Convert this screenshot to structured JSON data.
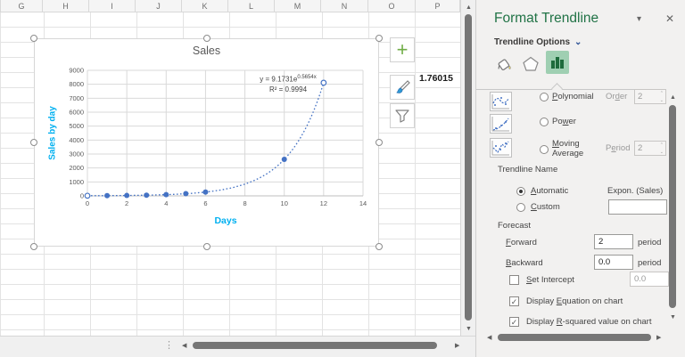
{
  "spreadsheet": {
    "columns": [
      "G",
      "H",
      "I",
      "J",
      "K",
      "L",
      "M",
      "N",
      "O",
      "P"
    ],
    "cell_value": "1.76015"
  },
  "chart_buttons": {
    "elements_icon": "+",
    "styles_icon": "brush",
    "filters_icon": "funnel"
  },
  "chart_data": {
    "type": "scatter",
    "title": "Sales",
    "xlabel": "Days",
    "ylabel": "Sales by day",
    "xlim": [
      0,
      14
    ],
    "ylim": [
      0,
      9000
    ],
    "x_ticks": [
      0,
      2,
      4,
      6,
      8,
      10,
      12,
      14
    ],
    "y_ticks": [
      0,
      1000,
      2000,
      3000,
      4000,
      5000,
      6000,
      7000,
      8000,
      9000
    ],
    "grid": true,
    "tick_color": "#595959",
    "axis_label_color": "#00b0f0",
    "series": [
      {
        "name": "Sales",
        "color": "#4472c4",
        "x": [
          1,
          2,
          3,
          4,
          5,
          6,
          10
        ],
        "y": [
          16,
          28,
          50,
          90,
          160,
          270,
          2620
        ]
      }
    ],
    "trendline": {
      "kind": "exponential",
      "a": 9.1731,
      "b": 0.5654,
      "x_start": 0,
      "x_end": 12,
      "color": "#4472c4",
      "style": "dotted",
      "equation_label": "y = 9.1731e",
      "equation_exp": "0.5654x",
      "r2_label": "R² = 0.9994"
    }
  },
  "panel": {
    "title": "Format Trendline",
    "dropdown_icon": "▾",
    "close_icon": "✕",
    "section_header": "Trendline Options",
    "section_chevron": "⌄",
    "options": {
      "polynomial": {
        "pre": "",
        "u": "P",
        "post": "olynomial"
      },
      "order": {
        "pre": "Or",
        "u": "d",
        "post": "er"
      },
      "order_value": "2",
      "power": {
        "pre": "Po",
        "u": "w",
        "post": "er"
      },
      "moving_average": {
        "pre": "",
        "u": "M",
        "post": "oving Average"
      },
      "period": {
        "pre": "P",
        "u": "e",
        "post": "riod"
      },
      "period_value": "2"
    },
    "trendline_name_label": "Trendline Name",
    "automatic": {
      "pre": "",
      "u": "A",
      "post": "utomatic"
    },
    "automatic_value": "Expon. (Sales)",
    "custom": {
      "pre": "",
      "u": "C",
      "post": "ustom"
    },
    "custom_value": "",
    "forecast_label": "Forecast",
    "forward": {
      "pre": "",
      "u": "F",
      "post": "orward"
    },
    "forward_value": "2",
    "forward_unit": "period",
    "backward": {
      "pre": "",
      "u": "B",
      "post": "ackward"
    },
    "backward_value": "0.0",
    "backward_unit": "period",
    "set_intercept": {
      "pre": "",
      "u": "S",
      "post": "et Intercept"
    },
    "set_intercept_value": "0.0",
    "display_equation": {
      "pre": "Display ",
      "u": "E",
      "post": "quation on chart"
    },
    "display_r2": {
      "pre": "Display ",
      "u": "R",
      "post": "-squared value on chart"
    },
    "check_glyph": "✓"
  },
  "scrollbars": {
    "up": "▲",
    "down": "▼",
    "left": "◀",
    "right": "▶",
    "splitter": "⋮"
  }
}
